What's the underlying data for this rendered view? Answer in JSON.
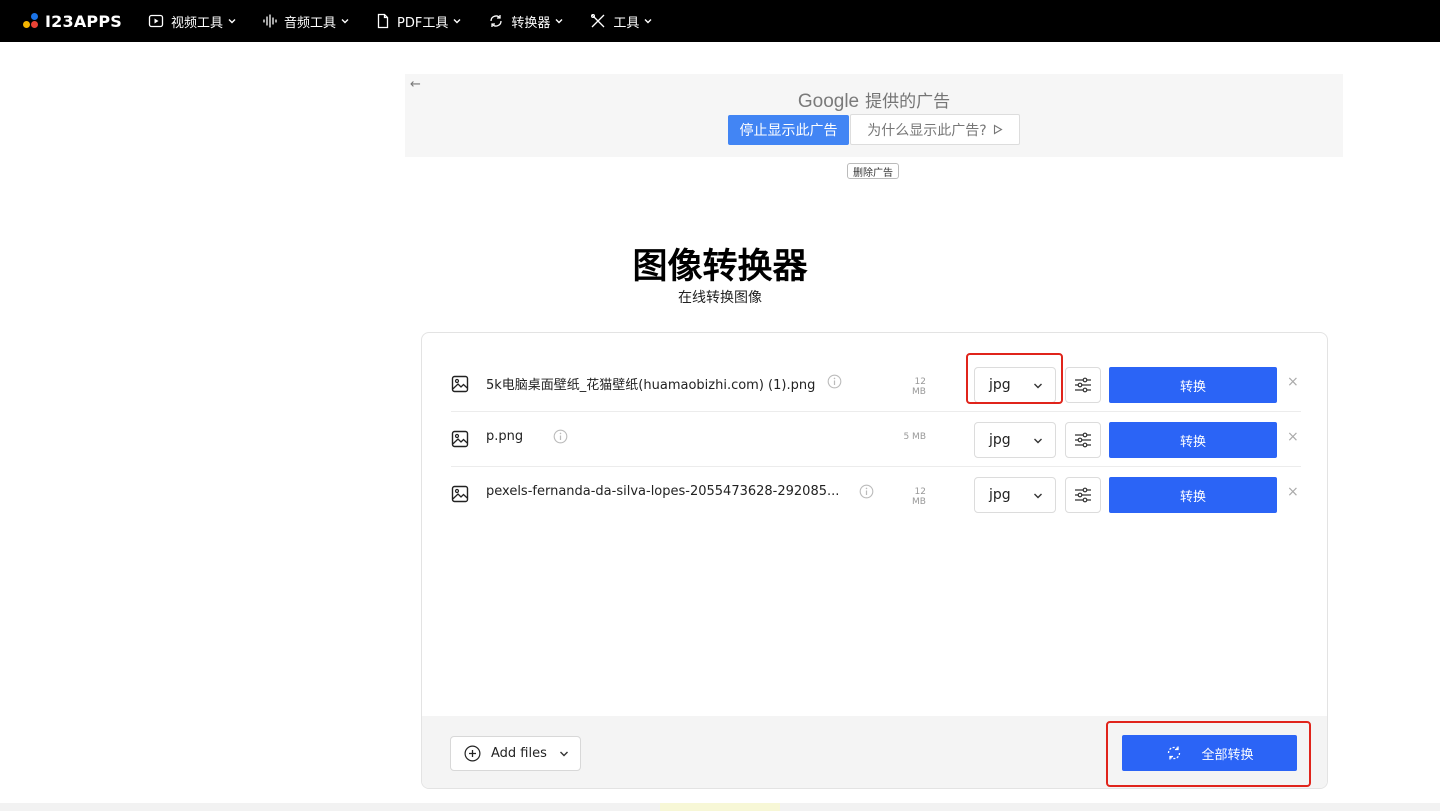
{
  "brand": {
    "name": "I23APPS",
    "dot_colors": [
      "#1a73e8",
      "#f4b400",
      "#ea4335"
    ]
  },
  "nav": [
    {
      "label": "视频工具",
      "icon": "play-icon"
    },
    {
      "label": "音频工具",
      "icon": "audio-wave-icon"
    },
    {
      "label": "PDF工具",
      "icon": "document-icon"
    },
    {
      "label": "转换器",
      "icon": "refresh-icon"
    },
    {
      "label": "工具",
      "icon": "tools-icon"
    }
  ],
  "ad": {
    "provider": "Google",
    "provider_suffix": "提供的广告",
    "stop_label": "停止显示此广告",
    "why_label": "为什么显示此广告?",
    "remove_label": "删除广告"
  },
  "page": {
    "title": "图像转换器",
    "subtitle": "在线转换图像"
  },
  "files": [
    {
      "name": "5k电脑桌面壁纸_花猫壁纸(huamaobizhi.com) (1).png",
      "size": "12 MB",
      "format": "jpg",
      "convert_label": "转换"
    },
    {
      "name": "p.png",
      "size": "5 MB",
      "format": "jpg",
      "convert_label": "转换"
    },
    {
      "name": "pexels-fernanda-da-silva-lopes-2055473628-292085...",
      "size": "12 MB",
      "format": "jpg",
      "convert_label": "转换"
    }
  ],
  "footer": {
    "add_files_label": "Add files",
    "convert_all_label": "全部转换"
  },
  "colors": {
    "accent": "#2b64f6",
    "highlight": "#e0241b"
  }
}
